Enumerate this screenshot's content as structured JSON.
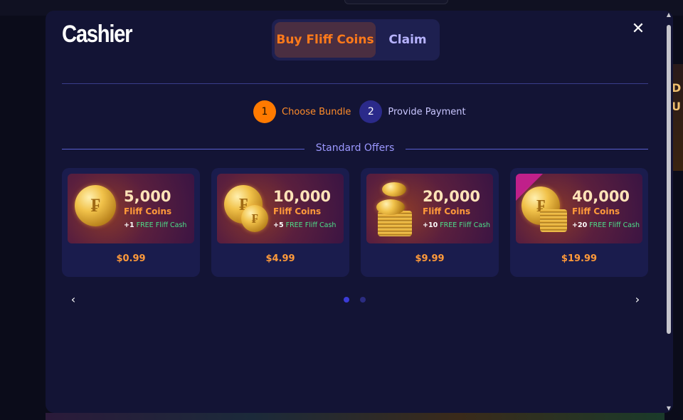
{
  "header": {
    "title": "Cashier",
    "tabs": [
      {
        "label": "Buy Fliff Coins",
        "active": true
      },
      {
        "label": "Claim",
        "active": false
      }
    ],
    "close_icon": "close-icon"
  },
  "steps": [
    {
      "number": "1",
      "label": "Choose Bundle",
      "active": true
    },
    {
      "number": "2",
      "label": "Provide Payment",
      "active": false
    }
  ],
  "section": {
    "title": "Standard Offers"
  },
  "bundles": [
    {
      "amount": "5,000",
      "unit": "Fliff Coins",
      "bonus_amount": "+1",
      "bonus_text": "FREE Fliff Cash",
      "price": "$0.99"
    },
    {
      "amount": "10,000",
      "unit": "Fliff Coins",
      "bonus_amount": "+5",
      "bonus_text": "FREE Fliff Cash",
      "price": "$4.99"
    },
    {
      "amount": "20,000",
      "unit": "Fliff Coins",
      "bonus_amount": "+10",
      "bonus_text": "FREE Fliff Cash",
      "price": "$9.99"
    },
    {
      "amount": "40,000",
      "unit": "Fliff Coins",
      "bonus_amount": "+20",
      "bonus_text": "FREE Fliff Cash",
      "price": "$19.99"
    }
  ],
  "pager": {
    "pages": 2,
    "current": 1,
    "prev_icon": "chevron-left-icon",
    "next_icon": "chevron-right-icon"
  },
  "colors": {
    "accent": "#ff7a1a",
    "modal_bg": "#131435",
    "card_bg": "#1a1c4d",
    "bonus_green": "#4de08a",
    "step_inactive": "#2b2a8a"
  }
}
